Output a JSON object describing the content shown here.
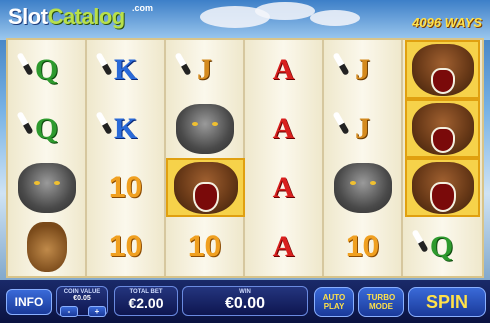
{
  "header": {
    "logo_slot": "Slot",
    "logo_catalog": "Catalog",
    "logo_com": ".com",
    "ways": "4096 WAYS"
  },
  "reels": [
    [
      "Q",
      "Q",
      "wolf",
      "rabbit"
    ],
    [
      "K",
      "K",
      "10",
      "10"
    ],
    [
      "J",
      "wolf",
      "bear",
      "10"
    ],
    [
      "A",
      "A",
      "A",
      "A"
    ],
    [
      "J",
      "J",
      "wolf",
      "10"
    ],
    [
      "bear",
      "bear",
      "bear",
      "Q"
    ]
  ],
  "controls": {
    "info_label": "INFO",
    "coin_value_label": "COIN VALUE",
    "coin_value": "€0.05",
    "minus_label": "-",
    "plus_label": "+",
    "total_bet_label": "TOTAL BET",
    "total_bet": "€2.00",
    "win_label": "WIN",
    "win_value": "€0.00",
    "autoplay_line1": "AUTO",
    "autoplay_line2": "PLAY",
    "turbo_line1": "TURBO",
    "turbo_line2": "MODE",
    "spin_label": "SPIN"
  },
  "colors": {
    "accent_yellow": "#ffe14a",
    "button_blue": "#2a4ab8",
    "panel_dark": "#0e1650"
  }
}
